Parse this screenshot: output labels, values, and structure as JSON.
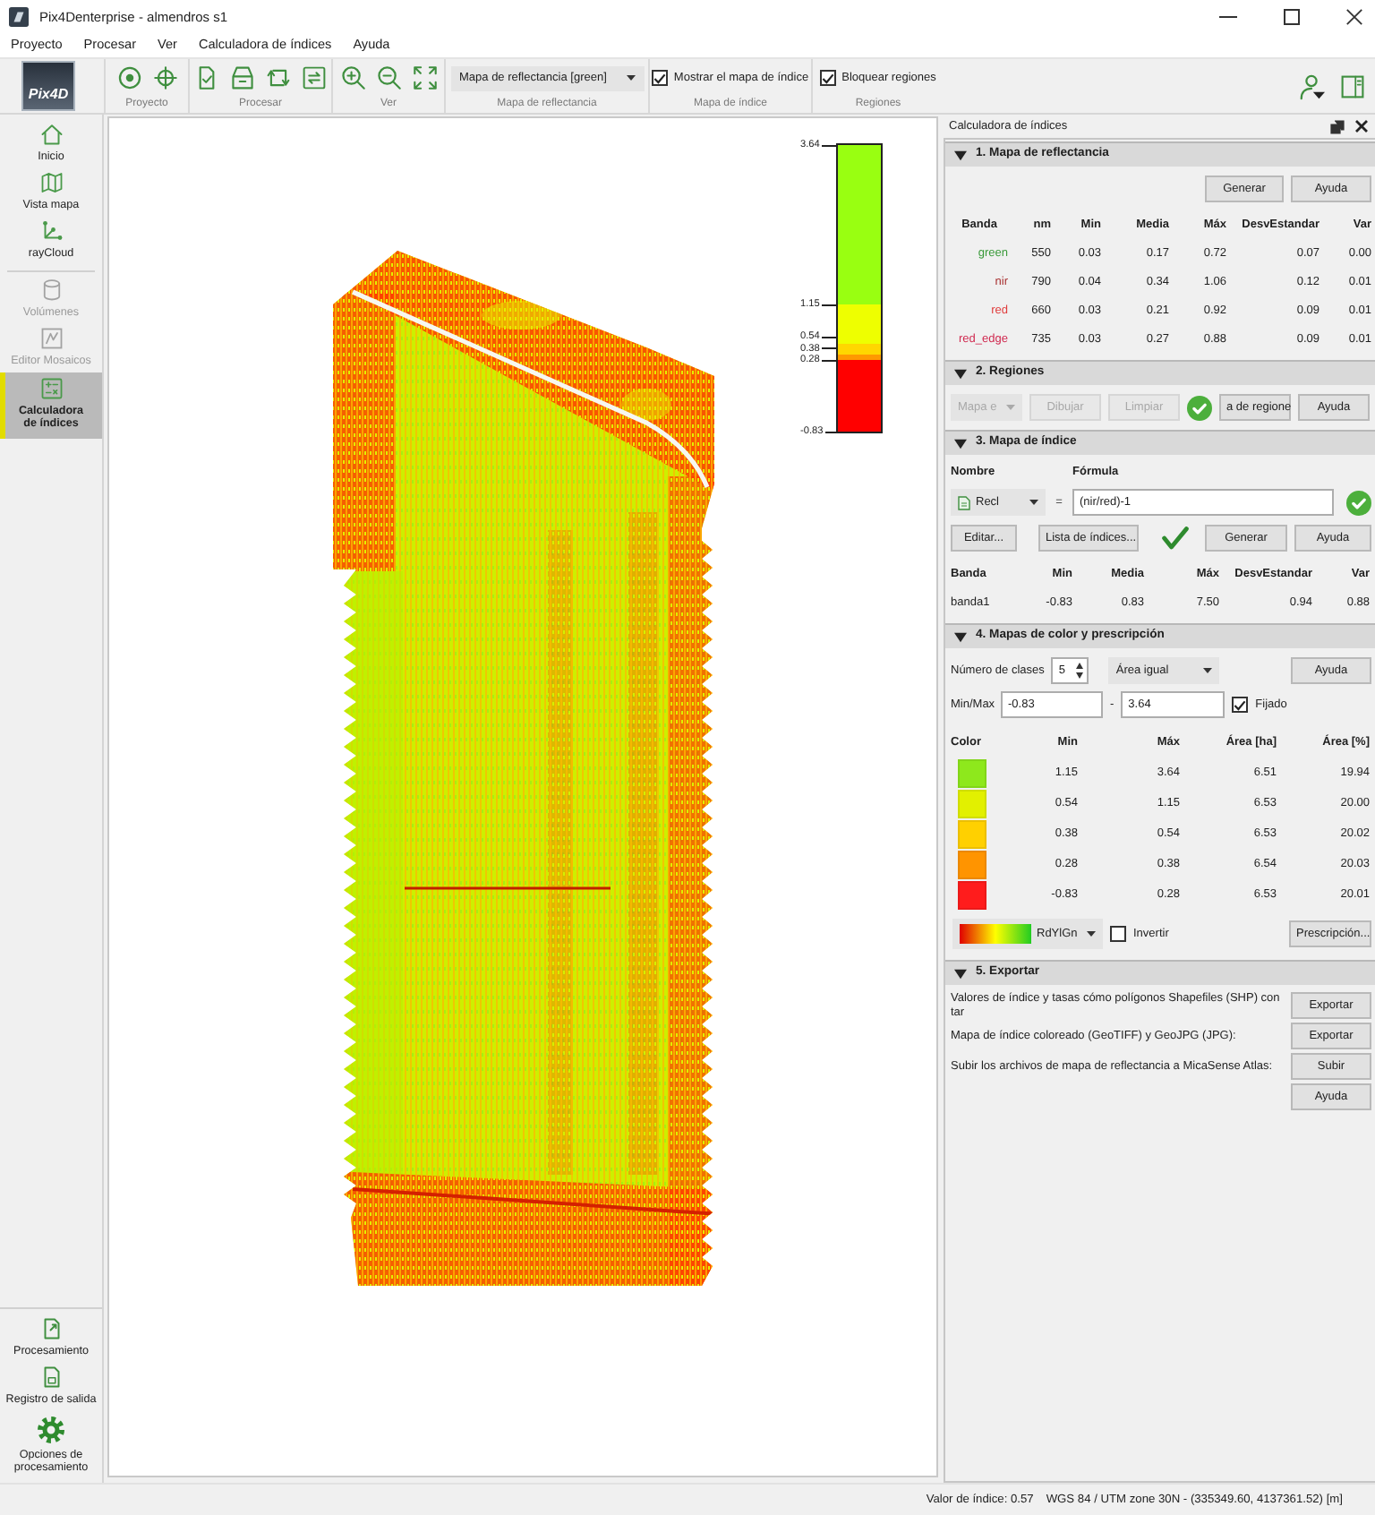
{
  "window": {
    "title": "Pix4Denterprise - almendros s1"
  },
  "menu": [
    "Proyecto",
    "Procesar",
    "Ver",
    "Calculadora de índices",
    "Ayuda"
  ],
  "toolbar": {
    "logo": "Pix4D",
    "groups": [
      {
        "kind": "icons",
        "label": "Proyecto"
      },
      {
        "kind": "icons",
        "label": "Procesar"
      },
      {
        "kind": "icons",
        "label": "Ver"
      },
      {
        "kind": "dropdown",
        "label": "Mapa de reflectancia",
        "value": "Mapa de reflectancia [green]"
      },
      {
        "kind": "checkbox",
        "label": "Mapa de índice",
        "text": "Mostrar el mapa de índice",
        "checked": true
      },
      {
        "kind": "checkbox",
        "label": "Regiones",
        "text": "Bloquear regiones",
        "checked": true
      }
    ]
  },
  "sidebar": {
    "groups": [
      {
        "items": [
          {
            "label": "Inicio",
            "selected": false,
            "disabled": false
          },
          {
            "label": "Vista mapa",
            "selected": false,
            "disabled": false
          },
          {
            "label": "rayCloud",
            "selected": false,
            "disabled": false
          }
        ]
      },
      {
        "items": [
          {
            "label": "Volúmenes",
            "selected": false,
            "disabled": true
          },
          {
            "label": "Editor Mosaicos",
            "selected": false,
            "disabled": true
          },
          {
            "label": "Calculadora de índices",
            "selected": true,
            "disabled": false
          }
        ]
      }
    ],
    "bottom_items": [
      "Procesamiento",
      "Registro de salida",
      "Opciones de procesamiento"
    ]
  },
  "map": {
    "legend": {
      "ticks": [
        "3.64",
        "1.15",
        "0.54",
        "0.38",
        "0.28",
        "-0.83"
      ],
      "segments": [
        {
          "color": "#99ff11"
        },
        {
          "color": "#eeff00"
        },
        {
          "color": "#ffd700"
        },
        {
          "color": "#ff9900"
        },
        {
          "color": "#ff0000"
        }
      ]
    }
  },
  "panel": {
    "title": "Calculadora de índices",
    "reflectance": {
      "title": "1. Mapa de reflectancia",
      "expanded": true,
      "buttons": [
        "Generar",
        "Ayuda"
      ],
      "columns": [
        "Banda",
        "nm",
        "Min",
        "Media",
        "Máx",
        "DesvEstandar",
        "Var"
      ],
      "rows": [
        {
          "color": "#3a9a3a",
          "cells": [
            "green",
            "550",
            "0.03",
            "0.17",
            "0.72",
            "0.07",
            "0.00"
          ]
        },
        {
          "color": "#a83030",
          "cells": [
            "nir",
            "790",
            "0.04",
            "0.34",
            "1.06",
            "0.12",
            "0.01"
          ]
        },
        {
          "color": "#e03c3c",
          "cells": [
            "red",
            "660",
            "0.03",
            "0.21",
            "0.92",
            "0.09",
            "0.01"
          ]
        },
        {
          "color": "#d02a50",
          "cells": [
            "red_edge",
            "735",
            "0.03",
            "0.27",
            "0.88",
            "0.09",
            "0.01"
          ]
        }
      ]
    },
    "regions": {
      "title": "2. Regiones",
      "expanded": true,
      "controls": [
        {
          "kind": "dropdown",
          "label": "Mapa e",
          "disabled": true
        },
        {
          "kind": "button",
          "label": "Dibujar",
          "disabled": true
        },
        {
          "kind": "button",
          "label": "Limpiar",
          "disabled": true
        },
        {
          "kind": "status",
          "disabled": false
        },
        {
          "kind": "button",
          "label": "a de regione",
          "disabled": false
        },
        {
          "kind": "button",
          "label": "Ayuda",
          "disabled": false
        }
      ]
    },
    "index_map": {
      "title": "3. Mapa de índice",
      "expanded": true,
      "name_label": "Nombre",
      "formula_label": "Fórmula",
      "index_name": "Recl",
      "equals": "=",
      "formula": "(nir/red)-1",
      "actions": [
        {
          "kind": "button",
          "label": "Editar..."
        },
        {
          "kind": "button",
          "label": "Lista de índices..."
        },
        {
          "kind": "tick"
        },
        {
          "kind": "button",
          "label": "Generar"
        },
        {
          "kind": "button",
          "label": "Ayuda"
        }
      ],
      "columns": [
        "Banda",
        "Min",
        "Media",
        "Máx",
        "DesvEstandar",
        "Var"
      ],
      "rows": [
        {
          "cells": [
            "banda1",
            "-0.83",
            "0.83",
            "7.50",
            "0.94",
            "0.88"
          ]
        }
      ]
    },
    "color_maps": {
      "title": "4. Mapas de color y prescripción",
      "expanded": true,
      "classes_label": "Número de clases",
      "classes": "5",
      "method": "Área igual",
      "help": "Ayuda",
      "minmax_label": "Min/Max",
      "min": "-0.83",
      "separator": "-",
      "max": "3.64",
      "fixed": {
        "label": "Fijado",
        "checked": true
      },
      "columns": [
        "Color",
        "Min",
        "Máx",
        "Área [ha]",
        "Área [%]"
      ],
      "rows": [
        {
          "color": "#8ee81c",
          "cells": [
            "",
            "1.15",
            "3.64",
            "6.51",
            "19.94"
          ]
        },
        {
          "color": "#e2f000",
          "cells": [
            "",
            "0.54",
            "1.15",
            "6.53",
            "20.00"
          ]
        },
        {
          "color": "#ffd000",
          "cells": [
            "",
            "0.38",
            "0.54",
            "6.53",
            "20.02"
          ]
        },
        {
          "color": "#ff9400",
          "cells": [
            "",
            "0.28",
            "0.38",
            "6.54",
            "20.03"
          ]
        },
        {
          "color": "#ff1c1c",
          "cells": [
            "",
            "-0.83",
            "0.28",
            "6.53",
            "20.01"
          ]
        }
      ],
      "palette": "RdYlGn",
      "invert": {
        "label": "Invertir",
        "checked": false
      },
      "prescription": "Prescripción..."
    },
    "export": {
      "title": "5. Exportar",
      "expanded": true,
      "rows": [
        {
          "label": "Valores de índice y tasas cómo polígonos Shapefiles (SHP) con tar",
          "button": "Exportar"
        },
        {
          "label": "Mapa de índice coloreado (GeoTIFF) y GeoJPG (JPG):",
          "button": "Exportar"
        },
        {
          "label": "Subir los archivos de mapa de reflectancia a MicaSense Atlas:",
          "button": "Subir"
        }
      ],
      "help": "Ayuda"
    }
  },
  "status_bar": [
    "Valor de índice: 0.57",
    "WGS 84 / UTM zone 30N - (335349.60, 4137361.52) [m]"
  ]
}
